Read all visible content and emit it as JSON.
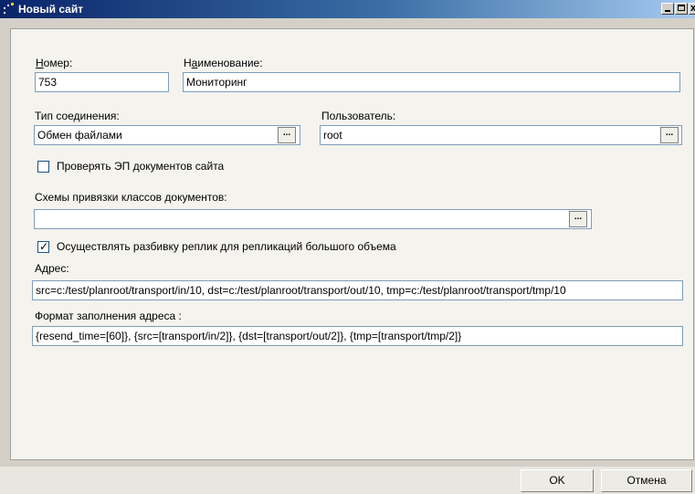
{
  "window": {
    "title": "Новый сайт",
    "minimize_symbol": "",
    "close_symbol": "x"
  },
  "form": {
    "number_label_accel": "Н",
    "number_label_rest": "омер:",
    "number_value": "753",
    "name_label_pre": "Н",
    "name_label_accel": "а",
    "name_label_rest": "именование:",
    "name_value": "Мониторинг",
    "connection_type_label": "Тип соединения:",
    "connection_type_value": "Обмен файлами",
    "user_label": "Пользователь:",
    "user_value": "root",
    "verify_signature_label": "Проверять ЭП документов сайта",
    "verify_signature_checked": false,
    "binding_schemes_label": "Схемы привязки классов документов:",
    "binding_schemes_value": "",
    "split_replicas_label": "Осуществлять разбивку реплик для репликаций большого объема",
    "split_replicas_checked": true,
    "address_label": "Адрес:",
    "address_value": "src=c:/test/planroot/transport/in/10, dst=c:/test/planroot/transport/out/10, tmp=c:/test/planroot/transport/tmp/10",
    "address_format_label": "Формат заполнения адреса :",
    "address_format_value": "{resend_time=[60]}, {src=[transport/in/2]}, {dst=[transport/out/2]}, {tmp=[transport/tmp/2]}",
    "ellipsis": "..."
  },
  "buttons": {
    "ok": "OK",
    "cancel": "Отмена"
  },
  "colors": {
    "titlebar_start": "#0a246a",
    "titlebar_end": "#a6caf0",
    "dialog_bg": "#d4d0c8",
    "panel_bg": "#f4f3ee",
    "field_border": "#7f9db9"
  }
}
